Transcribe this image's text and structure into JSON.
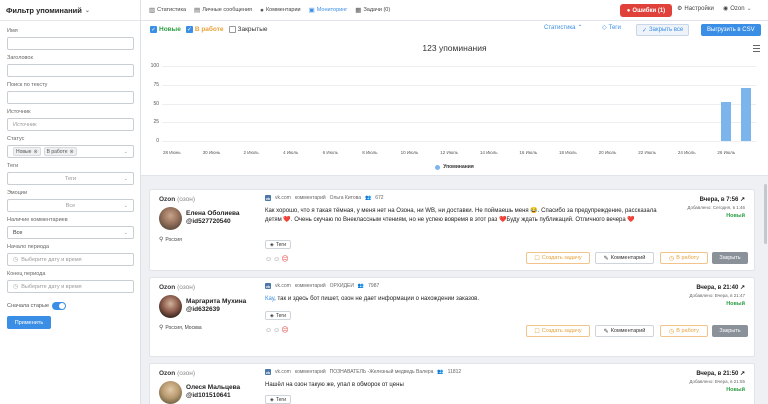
{
  "sidebar": {
    "title": "Фильтр упоминаний",
    "fields": [
      {
        "label": "Имя",
        "value": ""
      },
      {
        "label": "Заголовок",
        "value": ""
      },
      {
        "label": "Поиск по тексту",
        "value": ""
      },
      {
        "label": "Источник",
        "placeholder": "Источник"
      }
    ],
    "status_label": "Статус",
    "status_tags": [
      "Новые",
      "В работе"
    ],
    "tags_label": "Теги",
    "tags_placeholder": "Теги",
    "emotions_label": "Эмоции",
    "emotions_value": "Все",
    "comments_label": "Наличие комментариев",
    "comments_value": "Все",
    "start_label": "Начало периода",
    "start_placeholder": "Выберите дату и время",
    "end_label": "Конец периода",
    "end_placeholder": "Выберите дату и время",
    "old_first_label": "Сначала старые",
    "apply_label": "Применить"
  },
  "topnav": {
    "items": [
      "Статистика",
      "Личные сообщения",
      "Комментарии",
      "Мониторинг",
      "Задачи (0)"
    ],
    "errors_label": "Ошибки (1)",
    "settings_label": "Настройки",
    "user_label": "Ozon"
  },
  "filterbar": {
    "new_label": "Новые",
    "work_label": "В работе",
    "closed_label": "Закрытые",
    "stats_label": "Статистика",
    "tags_label": "Теги",
    "close_all_label": "Закрыть все",
    "export_label": "Выгрузить в CSV"
  },
  "chart_data": {
    "type": "bar",
    "title": "123 упоминания",
    "categories": [
      "28 Июнь",
      "29 Июнь",
      "30 Июнь",
      "1 Июль",
      "2 Июль",
      "3 Июль",
      "4 Июль",
      "5 Июль",
      "6 Июль",
      "7 Июль",
      "8 Июль",
      "9 Июль",
      "10 Июль",
      "11 Июль",
      "12 Июль",
      "13 Июль",
      "14 Июль",
      "15 Июль",
      "16 Июль",
      "17 Июль",
      "18 Июль",
      "19 Июль",
      "20 Июль",
      "21 Июль",
      "22 Июль",
      "23 Июль",
      "24 Июль",
      "25 Июль",
      "26 Июль",
      "27 Июль"
    ],
    "tick_labels": [
      "28 Июнь",
      "30 Июнь",
      "2 Июль",
      "4 Июль",
      "6 Июль",
      "8 Июль",
      "10 Июль",
      "12 Июль",
      "14 Июль",
      "16 Июль",
      "18 Июль",
      "20 Июль",
      "22 Июль",
      "24 Июль",
      "26 Июль"
    ],
    "values": [
      0,
      0,
      0,
      0,
      0,
      0,
      0,
      0,
      0,
      0,
      0,
      0,
      0,
      0,
      0,
      0,
      0,
      0,
      0,
      0,
      0,
      0,
      0,
      0,
      0,
      0,
      0,
      0,
      52,
      71
    ],
    "yticks": [
      0,
      25,
      50,
      75,
      100
    ],
    "ylim": [
      0,
      100
    ],
    "series_name": "Упоминания",
    "color": "#7cb5ec"
  },
  "mentions": [
    {
      "source": "Ozon",
      "source_sub": "(озон)",
      "author": "Елена Оболиева",
      "author_id": "@id527720540",
      "location": "Россия",
      "platform": "vk.com",
      "kind": "комментарий",
      "origin": "Ольга Китова",
      "followers": "672",
      "text_prefix": "",
      "text": "Как хорошо, что я такая тёмная, у меня нет на Озона, ни WB, ни доставки. Не поймаешь меня 😂. Спасибо за предупреждение, рассказала детям ❤️. Очень скучаю по Внеклассным чтениям, но не успею вовремя в этот раз ❤️Буду ждать публикаций. Отличного вечера ❤️",
      "date": "Вчера, в 7:56",
      "added": "Добавлено: Сегодня, в 1:46",
      "status": "Новый"
    },
    {
      "source": "Ozon",
      "source_sub": "(озон)",
      "author": "Маргарита Мухина",
      "author_id": "@id632639",
      "location": "Россия, Москва",
      "platform": "vk.com",
      "kind": "комментарий",
      "origin": "ОРХИДЕИ",
      "followers": "7987",
      "text_prefix": "Кау",
      "text": ", так и здесь бот пишет, озон не дает информации о нахождении заказов.",
      "date": "Вчера, в 21:40",
      "added": "Добавлено: Вчера, в 21:47",
      "status": "Новый"
    },
    {
      "source": "Ozon",
      "source_sub": "(озон)",
      "author": "Олеся Мальцева",
      "author_id": "@id101510641",
      "location": "",
      "platform": "vk.com",
      "kind": "комментарий",
      "origin": "ПОЗНАВАТЕЛЬ -Железный медведь Валера",
      "followers": "11812",
      "text_prefix": "",
      "text": "Нашёл на озон такую же, упал в обморок от цены",
      "date": "Вчера, в 21:50",
      "added": "Добавлено: Вчера, в 21:55",
      "status": "Новый"
    }
  ],
  "actions": {
    "create_task": "Создать задачу",
    "comment": "Комментарий",
    "to_work": "В работу",
    "close": "Закрыть",
    "tags": "Теги"
  }
}
